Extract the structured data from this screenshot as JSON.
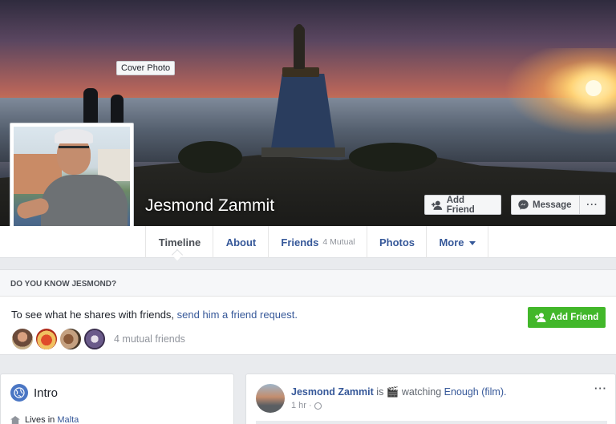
{
  "cover": {
    "tooltip": "Cover Photo"
  },
  "profile": {
    "name": "Jesmond Zammit"
  },
  "actions": {
    "add_friend": "Add Friend",
    "message": "Message",
    "more": "···"
  },
  "nav": {
    "tabs": [
      {
        "label": "Timeline",
        "sub": ""
      },
      {
        "label": "About",
        "sub": ""
      },
      {
        "label": "Friends",
        "sub": "4 Mutual"
      },
      {
        "label": "Photos",
        "sub": ""
      },
      {
        "label": "More",
        "sub": ""
      }
    ]
  },
  "know": {
    "header": "DO YOU KNOW JESMOND?",
    "text": "To see what he shares with friends, ",
    "link": "send him a friend request.",
    "button": "Add Friend",
    "mutual": "4 mutual friends"
  },
  "intro": {
    "title": "Intro",
    "lives_prefix": "Lives in ",
    "lives_place": "Malta"
  },
  "post": {
    "author": "Jesmond Zammit",
    "is": " is ",
    "icon": "🎬",
    "activity": " watching ",
    "film": "Enough (film).",
    "time": "1 hr ·",
    "dots": "···"
  },
  "colors": {
    "link": "#365899",
    "green": "#42b72a",
    "background": "#e9ebee"
  }
}
